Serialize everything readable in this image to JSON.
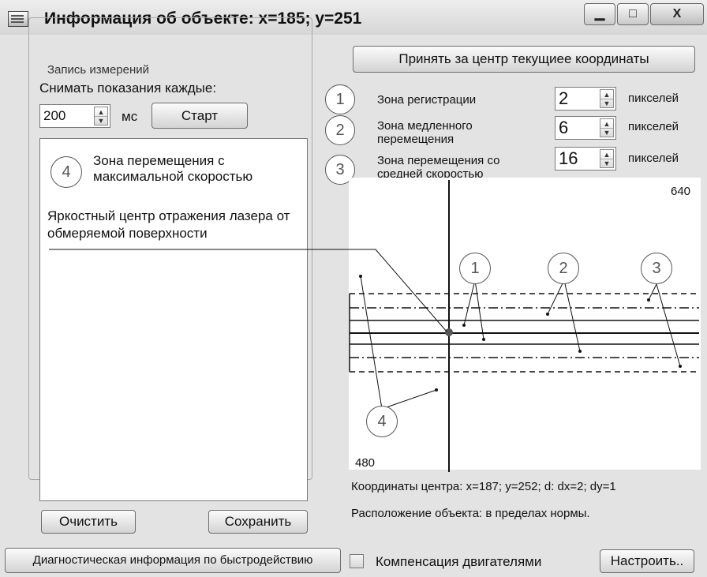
{
  "window": {
    "title": "Информация об объекте: x=185; y=251",
    "minimize_glyph": "▁",
    "maximize_glyph": "□",
    "close_glyph": "X",
    "icon": "app-icon"
  },
  "recording": {
    "group_title": "Запись измерений",
    "every_label": "Снимать показания каждые:",
    "interval_value": "200",
    "unit": "мс",
    "start_label": "Старт",
    "clear_label": "Очистить",
    "save_label": "Сохранить"
  },
  "center_button_label": "Принять за центр текущиее координаты",
  "zones": [
    {
      "marker": "1",
      "label": "Зона регистрации",
      "value": "2",
      "unit": "пикселей"
    },
    {
      "marker": "2",
      "label": "Зона медленного перемещения",
      "value": "6",
      "unit": "пикселей"
    },
    {
      "marker": "3",
      "label": "Зона перемещения со средней скоростью",
      "value": "16",
      "unit": "пикселей"
    }
  ],
  "annotations": {
    "zone4_marker": "4",
    "zone4_label": "Зона перемещения с максимальной скоростью",
    "laser_label": "Яркостный центр отражения лазера от обмеряемой поверхности"
  },
  "canvas": {
    "width_label": "640",
    "height_label": "480",
    "markers": [
      "1",
      "2",
      "3",
      "4"
    ]
  },
  "status": {
    "coordinates": "Координаты центра: x=187; y=252; d: dx=2; dy=1",
    "location": "Расположение объекта: в пределах нормы."
  },
  "bottom": {
    "diagnostics_label": "Диагностическая информация по быстродействию",
    "motor_compensation_label": "Компенсация двигателями",
    "motor_compensation_checked": false,
    "configure_label": "Настроить.."
  },
  "spin_glyphs": {
    "up": "▲",
    "down": "▼"
  }
}
